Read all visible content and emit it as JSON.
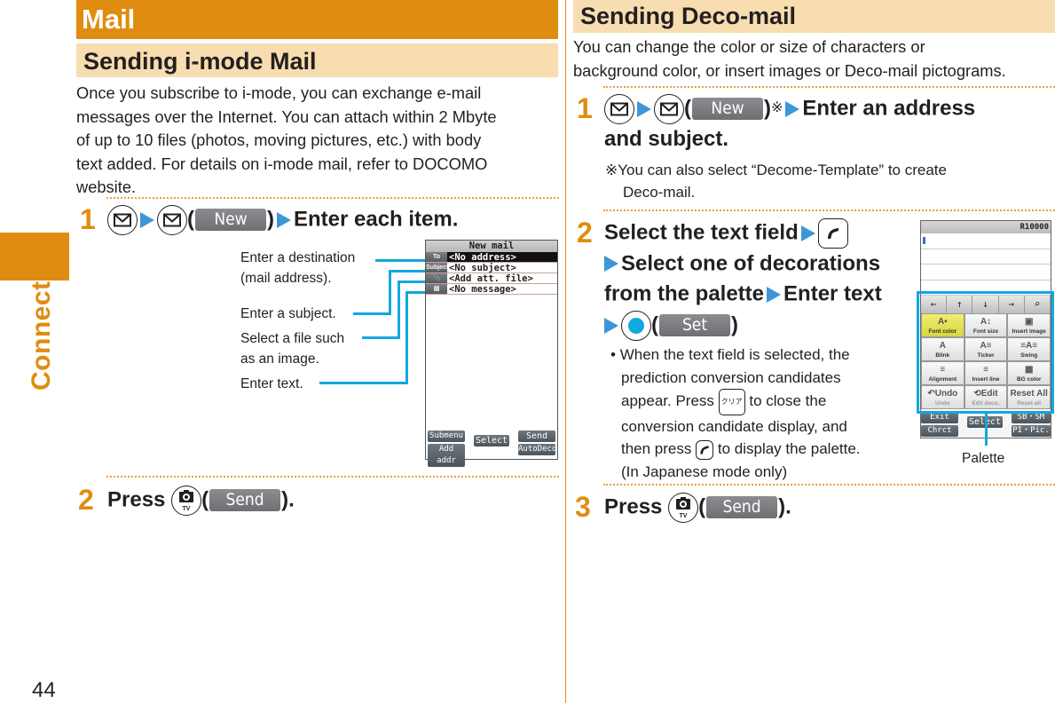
{
  "sidebar": {
    "section_label": "Connect",
    "page_number": "44"
  },
  "left": {
    "chapter_title": "Mail",
    "section_title": "Sending i-mode Mail",
    "intro_lines": [
      "Once you subscribe to i-mode, you can exchange e-mail",
      "messages over the Internet. You can attach within 2 Mbyte",
      "of up to 10 files (photos, moving pictures, etc.) with body",
      "text added. For details on i-mode mail, refer to DOCOMO",
      "website."
    ],
    "step1": {
      "number": "1",
      "softkey": "New",
      "text": "Enter each item."
    },
    "callouts": [
      "Enter a destination",
      "(mail address).",
      "Enter a subject.",
      "Select a file such",
      "as an image.",
      "Enter text."
    ],
    "phone": {
      "title": "New mail",
      "rows": [
        {
          "label": "To",
          "value": "<No address>",
          "selected": true
        },
        {
          "label": "Subject",
          "value": "<No subject>"
        },
        {
          "label": "paperclip-icon",
          "value": "<Add att. file>"
        },
        {
          "label": "message-icon",
          "value": "<No message>"
        }
      ],
      "softkeys": {
        "left_top": "Submenu",
        "left_bottom": "Add addr",
        "center": "Select",
        "right_top": "Send",
        "right_bottom": "AutoDeco"
      }
    },
    "step2": {
      "number": "2",
      "prefix": "Press",
      "softkey": "Send",
      "suffix": "."
    }
  },
  "right": {
    "section_title": "Sending Deco-mail",
    "intro_lines": [
      "You can change the color or size of characters or",
      "background color, or insert images or Deco-mail pictograms."
    ],
    "step1": {
      "number": "1",
      "softkey": "New",
      "note_mark": "※",
      "text_line1": "Enter an address",
      "text_line2": "and subject.",
      "note_line1": "※You can also select “Decome-Template” to create",
      "note_line2": "Deco-mail."
    },
    "step2": {
      "number": "2",
      "line1": "Select the text field",
      "line2": "Select one of decorations",
      "line3a": "from the palette",
      "line3b": "Enter text",
      "softkey": "Set",
      "bullet": "•",
      "note_lines": [
        "When the text field is selected, the",
        "prediction conversion candidates",
        "appear. Press",
        "to close the",
        "conversion candidate display, and",
        "then press",
        "to display the palette.",
        "(In Japanese mode only)"
      ],
      "clear_key": "クリア"
    },
    "phone": {
      "status": "R10000",
      "nav": [
        "←",
        "↑",
        "↓",
        "→",
        "⌕"
      ],
      "palette": [
        {
          "label": "Font color",
          "icon": "A▪",
          "highlight": true
        },
        {
          "label": "Font size",
          "icon": "A↕"
        },
        {
          "label": "Insert image",
          "icon": "▣"
        },
        {
          "label": "Blink",
          "icon": "A"
        },
        {
          "label": "Ticker",
          "icon": "A≡"
        },
        {
          "label": "Swing",
          "icon": "≡A≡"
        },
        {
          "label": "Alignment",
          "icon": "≡"
        },
        {
          "label": "Insert line",
          "icon": "≡"
        },
        {
          "label": "BG color",
          "icon": "▦"
        },
        {
          "label": "Undo",
          "icon": "↶Undo",
          "dim": true
        },
        {
          "label": "Edit deco.",
          "icon": "⟲Edit",
          "dim": true
        },
        {
          "label": "Reset all",
          "icon": "Reset All",
          "dim": true
        }
      ],
      "softkeys": {
        "left_top": "Exit",
        "left_bottom": "Chrct",
        "center": "Select",
        "right_top": "SB・SM",
        "right_bottom": "PI・Pic."
      },
      "caption": "Palette"
    },
    "step3": {
      "number": "3",
      "prefix": "Press",
      "softkey": "Send",
      "suffix": "."
    }
  },
  "colors": {
    "accent_orange": "#e08c10",
    "section_band": "#f7ddb0",
    "callout_blue": "#12a8e0",
    "arrow_blue": "#3d96d8"
  }
}
